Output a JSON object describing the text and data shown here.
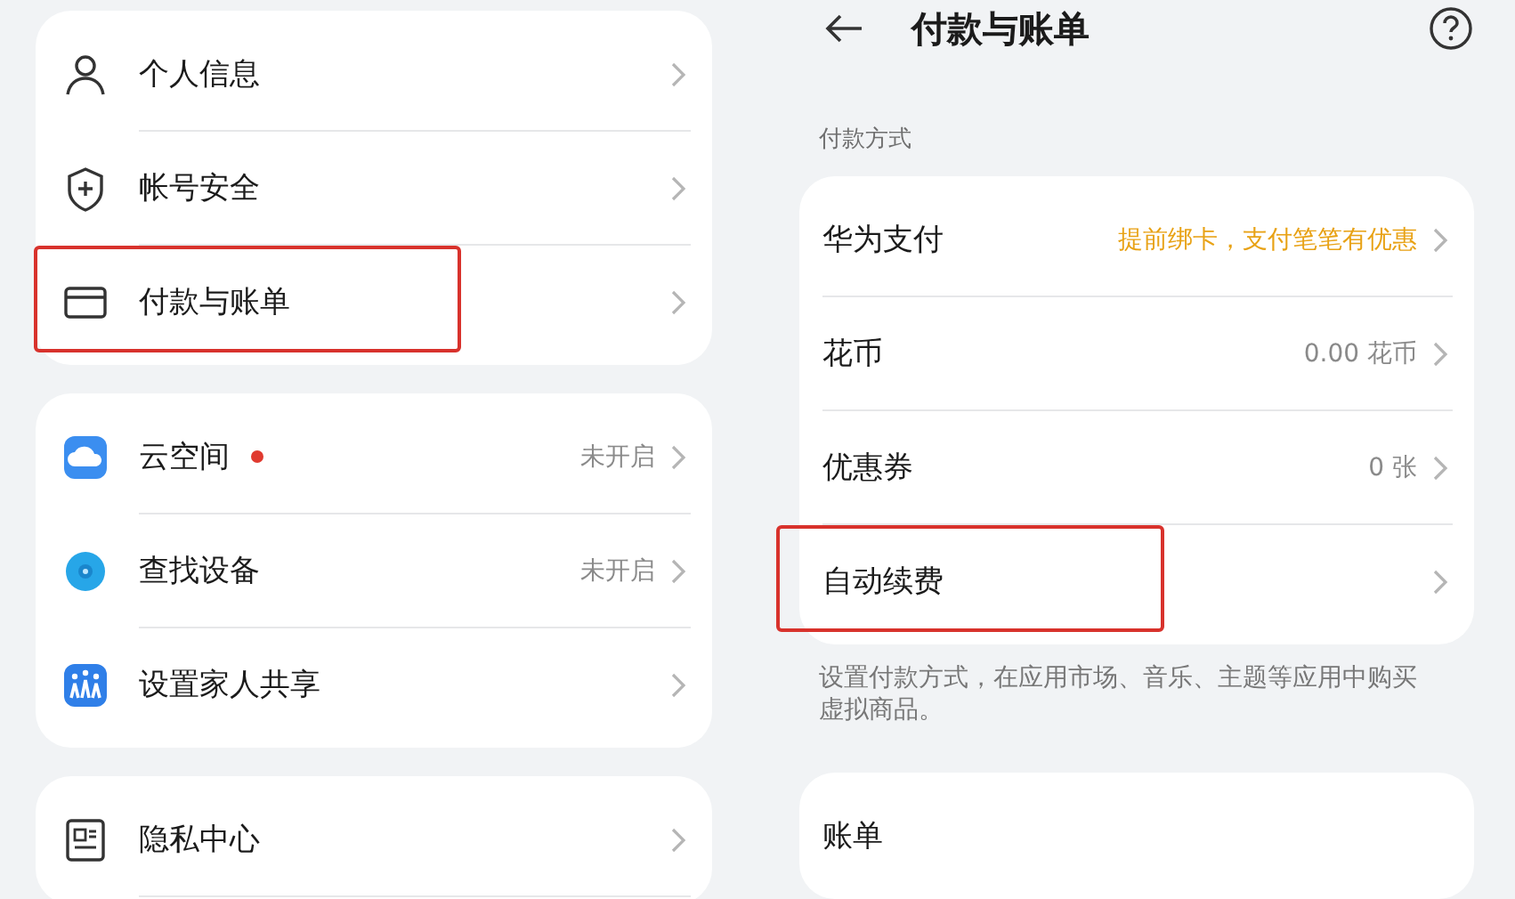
{
  "account_menu": {
    "groups": [
      {
        "items": [
          {
            "label": "个人信息",
            "highlighted": false
          },
          {
            "label": "帐号安全",
            "highlighted": false
          },
          {
            "label": "付款与账单",
            "highlighted": true
          }
        ]
      },
      {
        "items": [
          {
            "label": "云空间",
            "dot": true,
            "value": "未开启",
            "highlighted": false
          },
          {
            "label": "查找设备",
            "dot": false,
            "value": "未开启",
            "highlighted": false
          },
          {
            "label": "设置家人共享",
            "dot": false,
            "highlighted": false
          }
        ]
      },
      {
        "items": [
          {
            "label": "隐私中心",
            "highlighted": false
          }
        ]
      }
    ]
  },
  "payment_page": {
    "title": "付款与账单",
    "section_title": "付款方式",
    "items": [
      {
        "label": "华为支付",
        "value": "提前绑卡，支付笔笔有优惠",
        "accent": true,
        "highlighted": false
      },
      {
        "label": "花币",
        "value": "0.00 花币",
        "accent": false,
        "highlighted": false
      },
      {
        "label": "优惠券",
        "value": "0 张",
        "accent": false,
        "highlighted": false
      },
      {
        "label": "自动续费",
        "highlighted": true
      }
    ],
    "note": "设置付款方式，在应用市场、音乐、主题等应用中购买虚拟商品。",
    "bills_item": {
      "label": "账单"
    }
  }
}
